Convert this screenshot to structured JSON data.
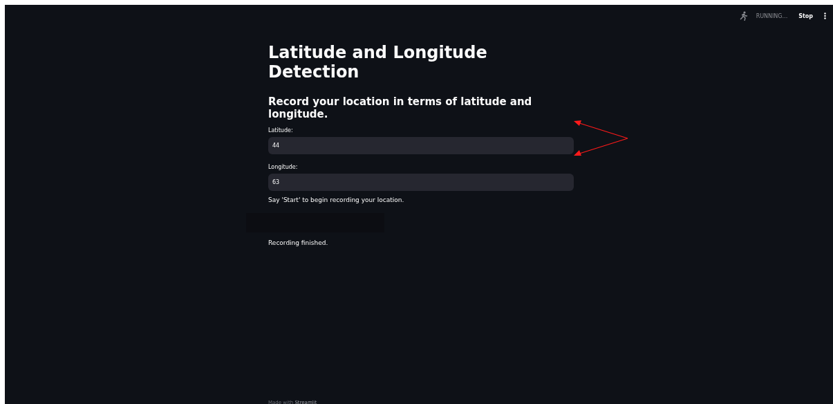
{
  "header": {
    "status": "RUNNING...",
    "stop_label": "Stop"
  },
  "title": "Latitude and Longitude Detection",
  "subtitle": "Record your location in terms of latitude and longitude.",
  "fields": [
    {
      "label": "Latitude:",
      "value": "44"
    },
    {
      "label": "Longitude:",
      "value": "63"
    }
  ],
  "messages": [
    "Say 'Start' to begin recording your location.",
    "Recording finished."
  ],
  "footer": {
    "prefix": "Made with",
    "brand": "Streamlit"
  }
}
